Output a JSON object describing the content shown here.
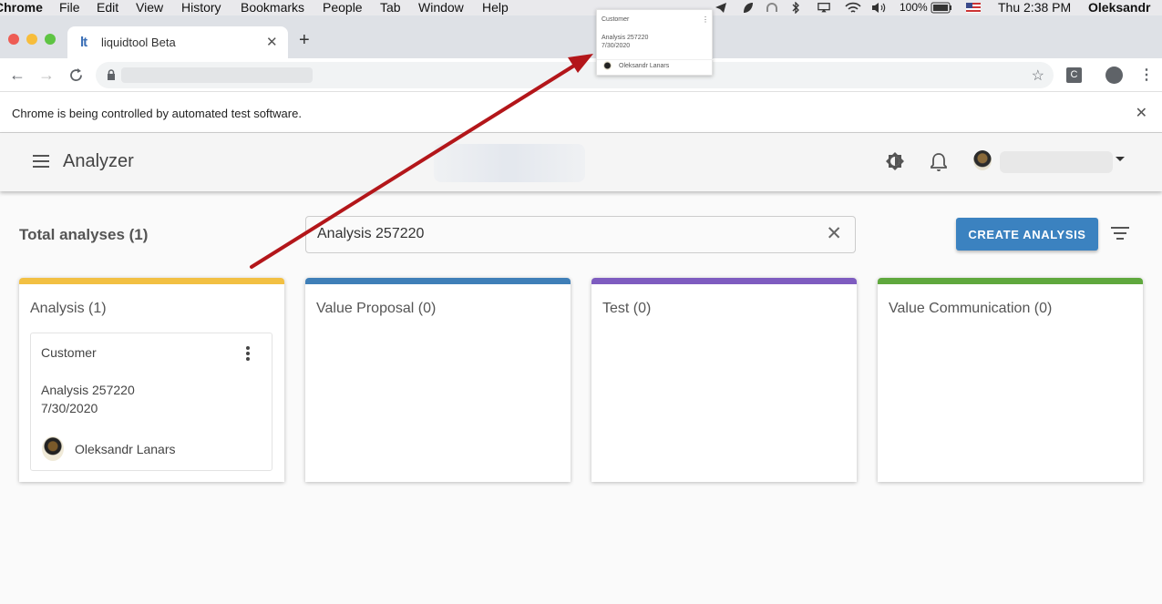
{
  "menubar": {
    "app": "Chrome",
    "items": [
      "File",
      "Edit",
      "View",
      "History",
      "Bookmarks",
      "People",
      "Tab",
      "Window",
      "Help"
    ],
    "battery": "100%",
    "clock": "Thu 2:38 PM",
    "user": "Oleksandr"
  },
  "browser": {
    "tab_title": "liquidtool Beta",
    "tab_favicon": "lt",
    "new_tab_label": "+",
    "infobar_text": "Chrome is being controlled by automated test software.",
    "extension_label": "C"
  },
  "header": {
    "title": "Analyzer"
  },
  "toolbar": {
    "total_label": "Total analyses (1)",
    "search_value": "Analysis 257220",
    "create_label": "CREATE ANALYSIS"
  },
  "columns": [
    {
      "title": "Analysis (1)",
      "color": "#f2c043"
    },
    {
      "title": "Value Proposal (0)",
      "color": "#3f7fb8"
    },
    {
      "title": "Test (0)",
      "color": "#7e5cc0"
    },
    {
      "title": "Value Communication (0)",
      "color": "#5fa83d"
    }
  ],
  "card": {
    "type": "Customer",
    "name": "Analysis 257220",
    "date": "7/30/2020",
    "owner": "Oleksandr Lanars"
  },
  "drag_ghost": {
    "type": "Customer",
    "name": "Analysis 257220",
    "date": "7/30/2020",
    "owner": "Oleksandr Lanars"
  },
  "annotation": {
    "arrow_color": "#b3161a"
  }
}
